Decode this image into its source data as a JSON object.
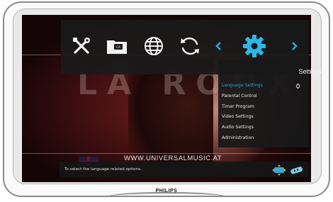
{
  "brand": "PHILIPS",
  "background": {
    "video_text": "LA ROUX",
    "url_text": "WWW.UNIVERSALMUSIC.AT"
  },
  "top_menu": {
    "icons": [
      "tools-icon",
      "card-folder-icon",
      "globe-icon",
      "refresh-icon",
      "chevron-left-icon",
      "gear-icon",
      "chevron-right-icon"
    ],
    "card_label": "CA"
  },
  "settings": {
    "title": "Settings",
    "items": [
      {
        "label": "Language Settings",
        "selected": true
      },
      {
        "label": "Parental Control"
      },
      {
        "label": "Timer Program"
      },
      {
        "label": "Video Settings"
      },
      {
        "label": "Audio Settings"
      },
      {
        "label": "Administration"
      }
    ]
  },
  "info_bar": {
    "text": "To select the language related options.",
    "icons": [
      "nav-arrows-icon",
      "remote-icon"
    ]
  },
  "colors": {
    "accent": "#2ba5e0",
    "panel": "#181818",
    "text": "#e8e8e8"
  }
}
